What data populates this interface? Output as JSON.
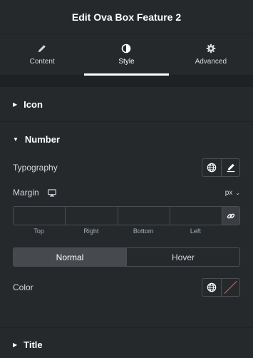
{
  "header": {
    "title": "Edit Ova Box Feature 2"
  },
  "tabs": [
    {
      "label": "Content",
      "icon": "pencil-icon"
    },
    {
      "label": "Style",
      "icon": "half-circle-icon",
      "active": true
    },
    {
      "label": "Advanced",
      "icon": "gear-icon"
    }
  ],
  "sections": {
    "icon": {
      "label": "Icon"
    },
    "number": {
      "label": "Number"
    },
    "title": {
      "label": "Title"
    }
  },
  "controls": {
    "typography_label": "Typography",
    "margin_label": "Margin",
    "margin_unit": "px",
    "margin_fields": [
      "Top",
      "Right",
      "Bottom",
      "Left"
    ],
    "state_normal": "Normal",
    "state_hover": "Hover",
    "color_label": "Color"
  },
  "colors": {
    "accent": "#ffffff",
    "clear_line": "#c94c4c"
  }
}
